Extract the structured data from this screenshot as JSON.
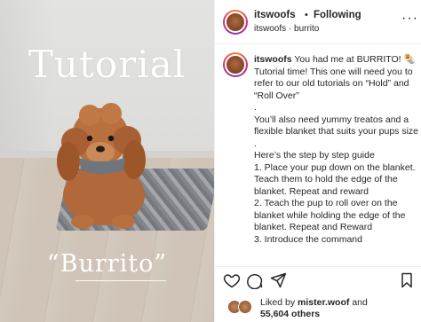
{
  "media": {
    "title": "Tutorial",
    "subtitle": "“Burrito”"
  },
  "header": {
    "username": "itswoofs",
    "separator": "•",
    "follow_status": "Following",
    "subtitle": "itswoofs · burrito",
    "more": "···"
  },
  "caption": {
    "username": "itswoofs",
    "headline": "You had me at BURRITO! 🌯",
    "lines": [
      "Tutorial time! This one will need you to refer to our old tutorials on “Hold” and “Roll Over”",
      ".",
      "You’ll also need yummy treatos and a flexible blanket that suits your pups size",
      ".",
      "Here’s the step by step guide",
      "1. Place your pup down on the blanket. Teach them to hold the edge of the blanket. Repeat and reward",
      "2. Teach the pup to roll over on the blanket while holding the edge of the blanket. Repeat and Reward",
      "3. Introduce the command"
    ]
  },
  "icons": {
    "like": "heart-icon",
    "comment": "comment-icon",
    "share": "send-icon",
    "save": "bookmark-icon"
  },
  "likes": {
    "prefix": "Liked by",
    "user": "mister.woof",
    "suffix": "and",
    "count_text": "55,604 others"
  }
}
